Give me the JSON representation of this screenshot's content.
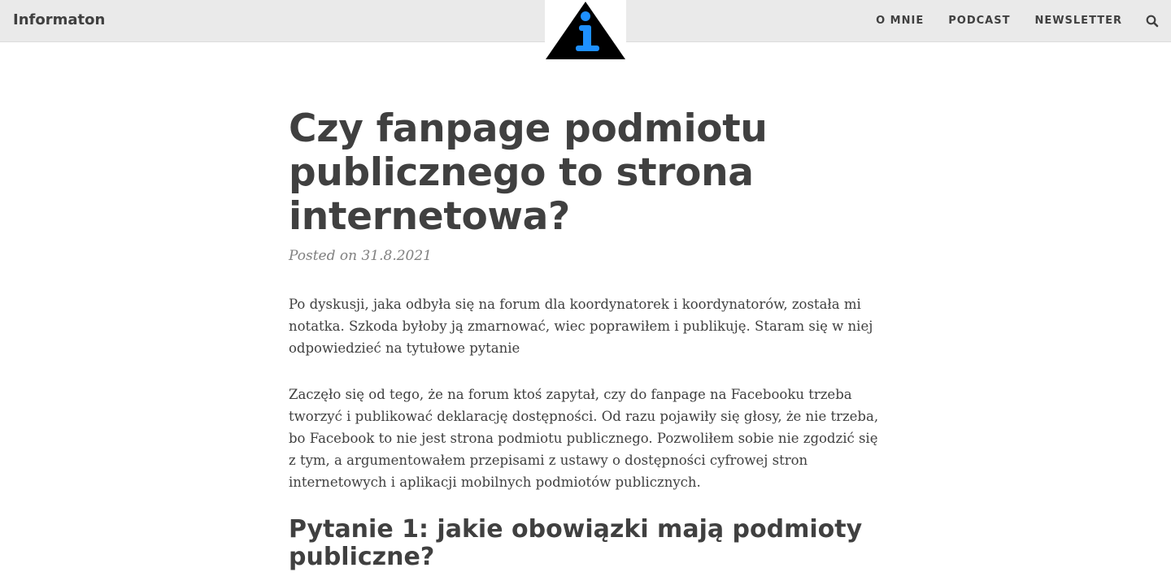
{
  "header": {
    "site_title": "Informaton",
    "logo_glyph": "i",
    "nav": [
      {
        "label": "O MNIE"
      },
      {
        "label": "PODCAST"
      },
      {
        "label": "NEWSLETTER"
      }
    ],
    "search_icon": "search-icon"
  },
  "post": {
    "title": "Czy fanpage podmiotu publicznego to strona internetowa?",
    "posted_on": "Posted on 31.8.2021",
    "paragraph_1": "Po dyskusji, jaka odbyła się na forum dla koordynatorek i koordynatorów, została mi notatka. Szkoda byłoby ją zmarnować, wiec poprawiłem i publikuję. Staram się w niej odpowiedzieć na tytułowe pytanie",
    "paragraph_2": "Zaczęło się od tego, że na forum ktoś zapytał, czy do fanpage na Facebooku trzeba tworzyć i publikować deklarację dostępności. Od razu pojawiły się głosy, że nie trzeba, bo Facebook to nie jest strona podmiotu publicznego. Pozwoliłem sobie nie zgodzić się z tym, a argumentowałem przepisami z ustawy o dostępności cyfrowej stron internetowych i aplikacji mobilnych podmiotów publicznych.",
    "heading_1": "Pytanie 1: jakie obowiązki mają podmioty publiczne?"
  },
  "colors": {
    "header_bg": "#eaeaea",
    "text": "#404040",
    "meta": "#808080",
    "logo_black": "#000000",
    "logo_blue": "#1e90ff"
  }
}
